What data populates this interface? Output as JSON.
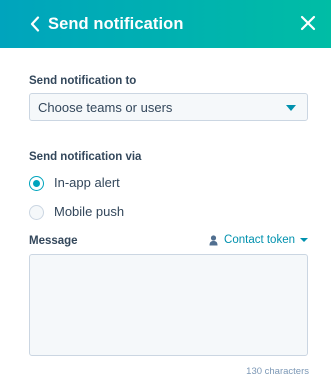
{
  "header": {
    "title": "Send notification",
    "back_icon": "chevron-left-icon",
    "close_icon": "close-icon",
    "gradient": [
      "#00a4bd",
      "#00bda5"
    ]
  },
  "recipients": {
    "label": "Send notification to",
    "select_value": "Choose teams or users"
  },
  "channel": {
    "label": "Send notification via",
    "options": [
      {
        "label": "In-app alert",
        "checked": true
      },
      {
        "label": "Mobile push",
        "checked": false
      }
    ]
  },
  "message": {
    "label": "Message",
    "token_link": "Contact token",
    "token_icon": "person-icon",
    "value": "",
    "char_count": "130 characters"
  },
  "colors": {
    "accent": "#00a4bd",
    "link": "#0091ae",
    "text": "#33475b",
    "muted": "#7c98b6",
    "field_bg": "#f5f8fa",
    "border": "#cbd6e2"
  }
}
